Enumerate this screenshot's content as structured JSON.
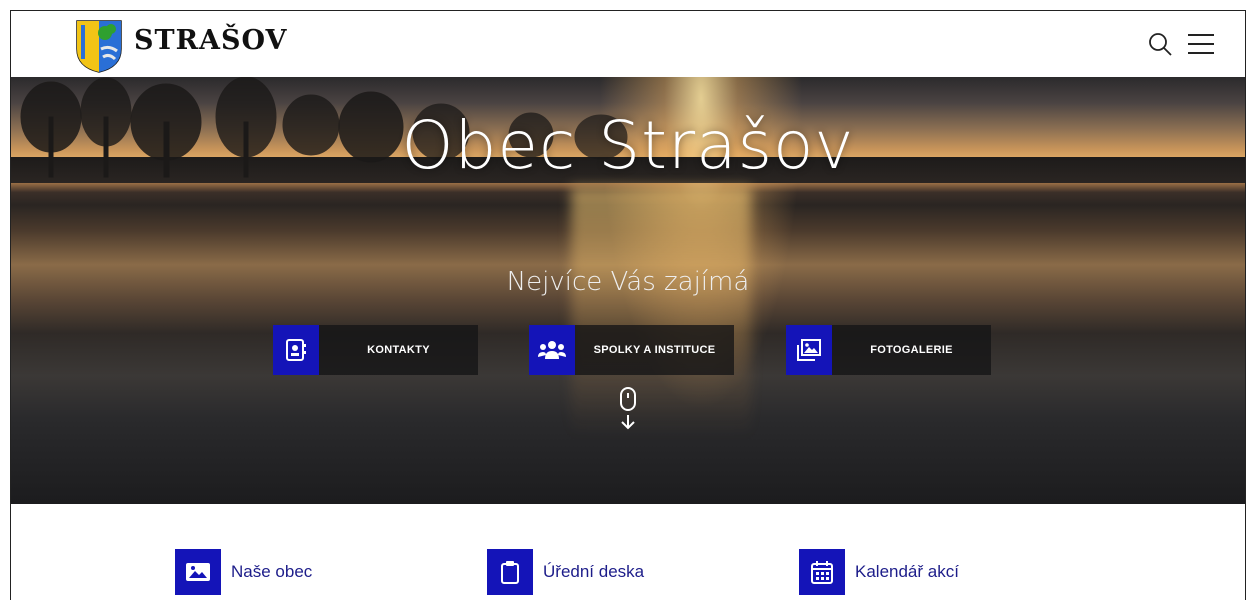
{
  "header": {
    "brand": "STRAŠOV",
    "search_icon": "search-icon",
    "menu_icon": "hamburger-menu-icon",
    "logo_icon": "coat-of-arms-logo"
  },
  "hero": {
    "title": "Obec Strašov",
    "subtitle": "Nejvíce Vás zajímá",
    "quick_links": [
      {
        "label": "KONTAKTY",
        "icon": "contact-book-icon"
      },
      {
        "label": "SPOLKY A INSTITUCE",
        "icon": "users-group-icon"
      },
      {
        "label": "FOTOGALERIE",
        "icon": "photo-gallery-icon"
      }
    ],
    "scroll_icon": "mouse-scroll-down-icon"
  },
  "sections": [
    {
      "label": "Naše obec",
      "icon": "image-icon"
    },
    {
      "label": "Úřední deska",
      "icon": "clipboard-icon"
    },
    {
      "label": "Kalendář akcí",
      "icon": "calendar-icon"
    }
  ],
  "colors": {
    "accent": "#1414b8",
    "link_text": "#1d1d8a",
    "header_bg": "#ffffff"
  }
}
